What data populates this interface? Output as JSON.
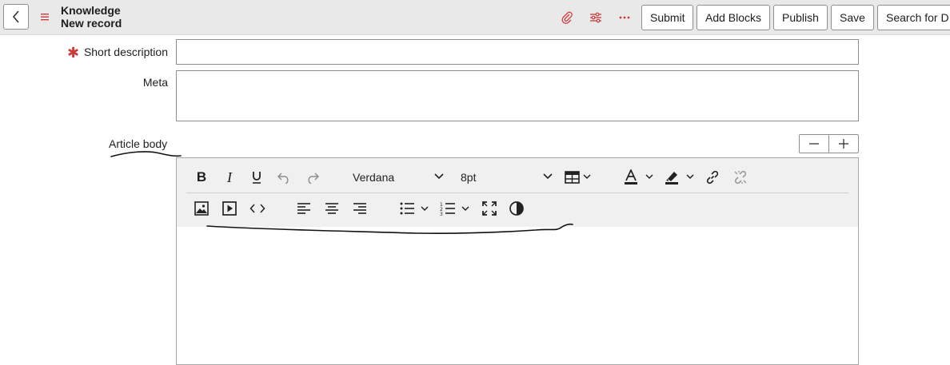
{
  "header": {
    "title": "Knowledge",
    "subtitle": "New record",
    "buttons": {
      "submit": "Submit",
      "add_blocks": "Add Blocks",
      "publish": "Publish",
      "save": "Save",
      "search": "Search for D"
    },
    "icons": [
      "chevron-left-icon",
      "hamburger-menu-icon",
      "paperclip-icon",
      "sliders-icon",
      "more-icon"
    ],
    "accent_color": "#c83c3c"
  },
  "form": {
    "short_description": {
      "label": "Short description",
      "value": "",
      "required": true
    },
    "meta": {
      "label": "Meta",
      "value": ""
    },
    "article_body": {
      "label": "Article body"
    },
    "zoom": {
      "minus": "−",
      "plus": "+"
    }
  },
  "editor": {
    "font_family": "Verdana",
    "font_size": "8pt",
    "toolbar_row1": [
      "bold",
      "italic",
      "underline",
      "undo",
      "redo",
      "font-family",
      "font-size",
      "table",
      "text-color",
      "highlight",
      "link",
      "unlink"
    ],
    "toolbar_row2": [
      "image",
      "media",
      "source-code",
      "align-left",
      "align-center",
      "align-right",
      "bullet-list",
      "numbered-list",
      "fullscreen",
      "contrast"
    ],
    "content": ""
  }
}
